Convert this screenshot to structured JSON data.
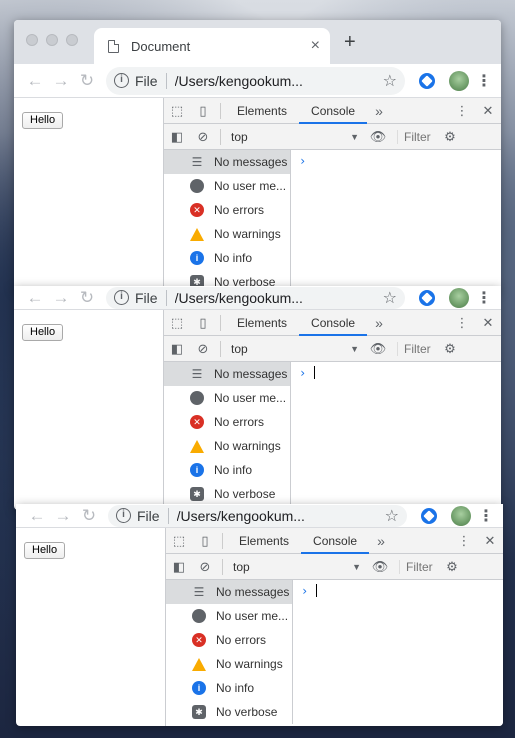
{
  "browser": {
    "tab_title": "Document",
    "tab_close": "×",
    "new_tab": "+",
    "back": "←",
    "forward": "→",
    "reload": "↻",
    "info": "i",
    "scheme": "File",
    "path": "/Users/kengookum...",
    "star": "☆",
    "menu": "⋮"
  },
  "page": {
    "hello_button": "Hello"
  },
  "devtools": {
    "inspect_icon": "⬚",
    "device_icon": "▯",
    "tabs": [
      "Elements",
      "Console"
    ],
    "more_tabs": "»",
    "menu": "⋮",
    "close": "✕",
    "sidebar_toggle": "◧",
    "clear_icon": "⊘",
    "context": "top",
    "caret": "▼",
    "eye_icon": "👁",
    "filter_placeholder": "Filter",
    "settings_icon": "⚙",
    "sidebar_items": [
      {
        "label": "No messages",
        "icon": "list-icon"
      },
      {
        "label": "No user me...",
        "icon": "user-icon"
      },
      {
        "label": "No errors",
        "icon": "error-icon"
      },
      {
        "label": "No warnings",
        "icon": "warning-icon"
      },
      {
        "label": "No info",
        "icon": "info-icon"
      },
      {
        "label": "No verbose",
        "icon": "verbose-icon"
      }
    ],
    "prompt": "›",
    "glyphs": {
      "list": "☰",
      "error": "✕",
      "warn": "!",
      "info": "i",
      "verbose": "✱"
    }
  },
  "colors": {
    "accent": "#1a73e8",
    "error": "#d93025",
    "warning": "#f9ab00"
  }
}
